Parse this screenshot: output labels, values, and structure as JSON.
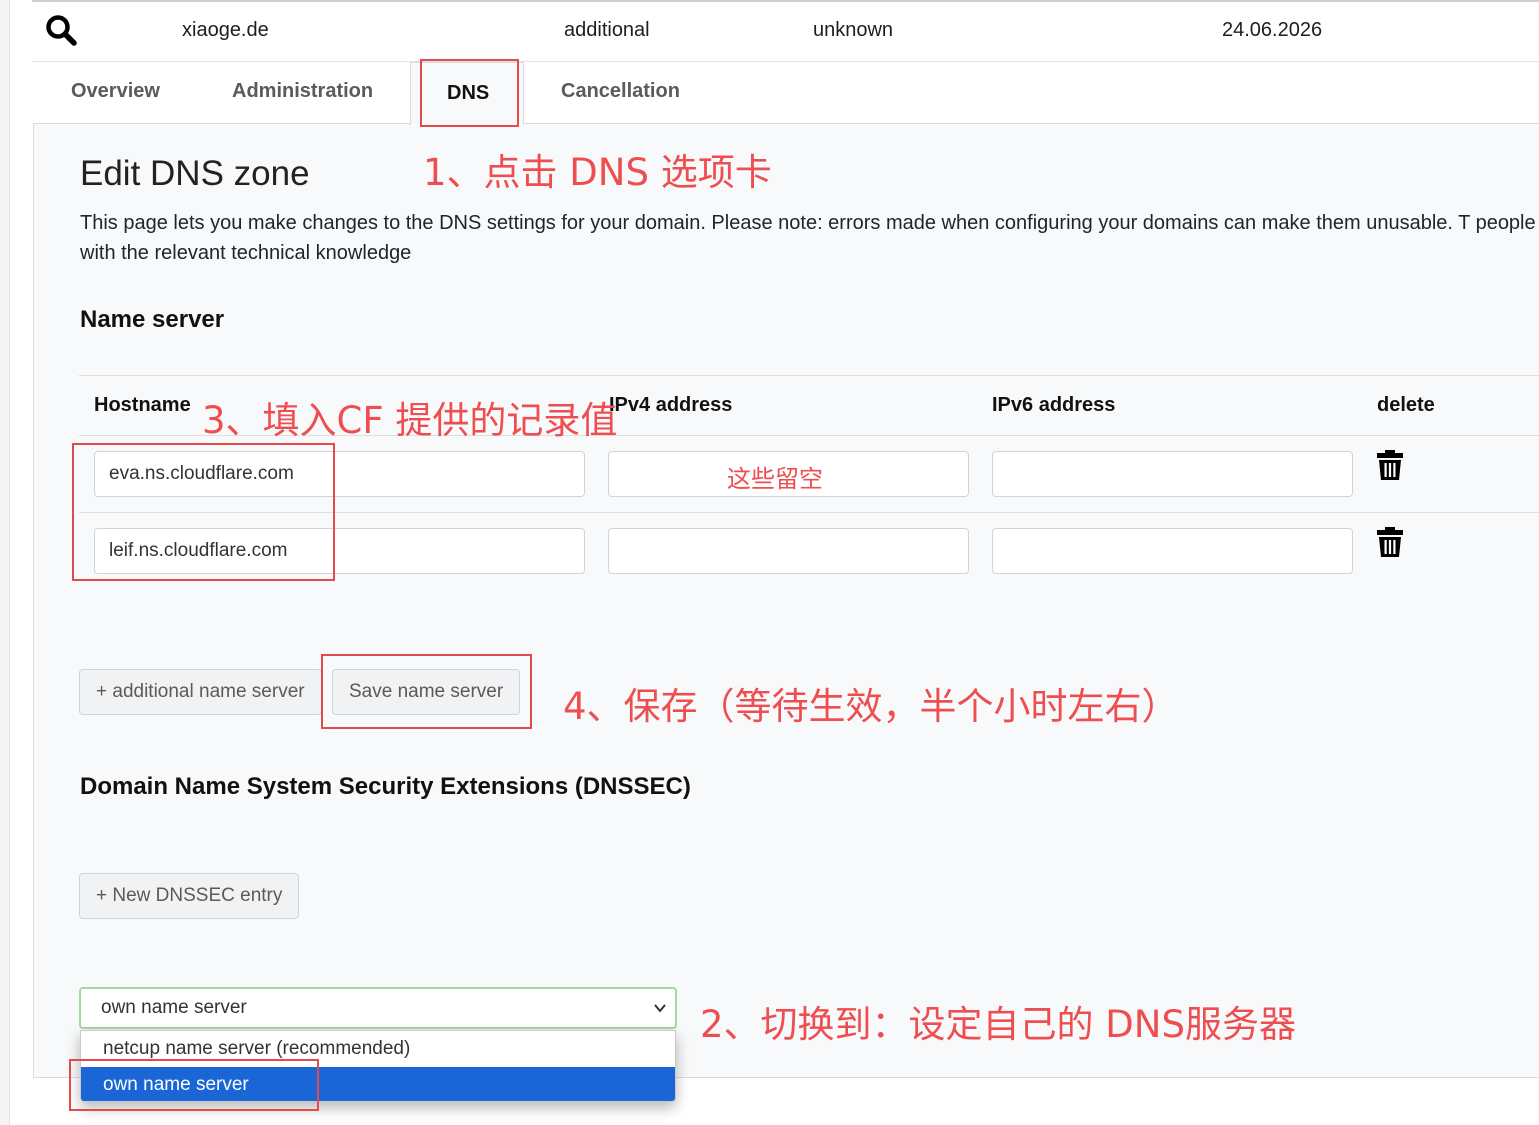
{
  "header": {
    "domain": "xiaoge.de",
    "type": "additional",
    "status": "unknown",
    "date": "24.06.2026",
    "search_icon": "search-icon"
  },
  "tabs": [
    {
      "label": "Overview",
      "active": false
    },
    {
      "label": "Administration",
      "active": false
    },
    {
      "label": "DNS",
      "active": true
    },
    {
      "label": "Cancellation",
      "active": false
    }
  ],
  "page": {
    "title": "Edit DNS zone",
    "description": "This page lets you make changes to the DNS settings for your domain. Please note: errors made when configuring your domains can make them unusable. T people with the relevant technical knowledge"
  },
  "nameserver": {
    "title": "Name server",
    "columns": [
      "Hostname",
      "IPv4 address",
      "IPv6 address",
      "delete"
    ],
    "rows": [
      {
        "hostname": "eva.ns.cloudflare.com",
        "ipv4": "",
        "ipv6": ""
      },
      {
        "hostname": "leif.ns.cloudflare.com",
        "ipv4": "",
        "ipv6": ""
      }
    ],
    "add_button": "+ additional name server",
    "save_button": "Save name server"
  },
  "dnssec": {
    "title": "Domain Name System Security Extensions (DNSSEC)",
    "new_button": "+ New DNSSEC entry"
  },
  "select": {
    "value": "own name server",
    "options": [
      {
        "label": "netcup name server (recommended)",
        "selected": false
      },
      {
        "label": "own name server",
        "selected": true
      }
    ]
  },
  "annotations": {
    "step1": "1、点击 DNS 选项卡",
    "step2": "2、切换到：设定自己的 DNS服务器",
    "step3": "3、填入CF 提供的记录值",
    "step4": "4、保存（等待生效，半个小时左右）",
    "leave_empty": "这些留空"
  },
  "colors": {
    "annotation": "#ee4e4f",
    "selected_option": "#1a66d6",
    "panel_bg": "#f8f9fa"
  }
}
